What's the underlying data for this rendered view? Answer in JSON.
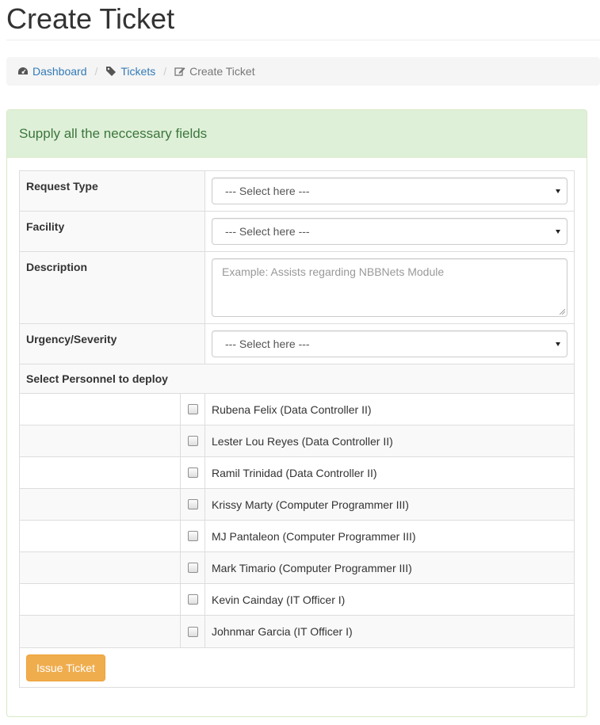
{
  "page": {
    "title": "Create Ticket"
  },
  "breadcrumb": {
    "items": [
      {
        "label": "Dashboard",
        "icon": "dashboard-icon"
      },
      {
        "label": "Tickets",
        "icon": "tag-icon"
      },
      {
        "label": "Create Ticket",
        "icon": "edit-icon"
      }
    ],
    "separator": "/"
  },
  "panel": {
    "heading": "Supply all the neccessary fields"
  },
  "form": {
    "request_type": {
      "label": "Request Type",
      "value": "--- Select here ---"
    },
    "facility": {
      "label": "Facility",
      "value": "--- Select here ---"
    },
    "description": {
      "label": "Description",
      "placeholder": "Example: Assists regarding NBBNets Module"
    },
    "urgency": {
      "label": "Urgency/Severity",
      "value": "--- Select here ---"
    }
  },
  "personnel": {
    "header": "Select Personnel to deploy",
    "items": [
      "Rubena Felix (Data Controller II)",
      "Lester Lou Reyes (Data Controller II)",
      "Ramil Trinidad (Data Controller II)",
      "Krissy Marty (Computer Programmer III)",
      "MJ Pantaleon (Computer Programmer III)",
      "Mark Timario (Computer Programmer III)",
      "Kevin Cainday (IT Officer I)",
      "Johnmar Garcia (IT Officer I)"
    ]
  },
  "actions": {
    "issue_label": "Issue Ticket"
  },
  "colors": {
    "link": "#337ab7",
    "panel_heading_bg": "#dff0d8",
    "panel_heading_text": "#3c763d",
    "warning_button": "#f0ad4e"
  }
}
